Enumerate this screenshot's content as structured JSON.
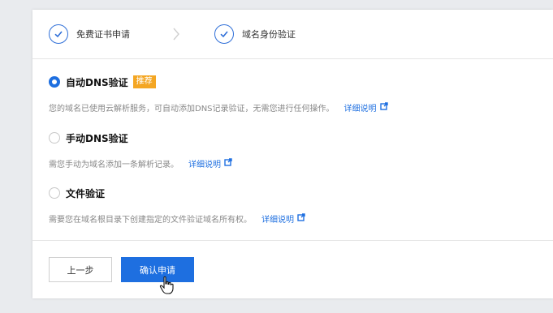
{
  "steps": [
    {
      "label": "免费证书申请"
    },
    {
      "label": "域名身份验证"
    }
  ],
  "options": [
    {
      "title": "自动DNS验证",
      "badge": "推荐",
      "selected": true,
      "description": "您的域名已使用云解析服务，可自动添加DNS记录验证，无需您进行任何操作。",
      "link": "详细说明"
    },
    {
      "title": "手动DNS验证",
      "selected": false,
      "description": "需您手动为域名添加一条解析记录。",
      "link": "详细说明"
    },
    {
      "title": "文件验证",
      "selected": false,
      "description": "需要您在域名根目录下创建指定的文件验证域名所有权。",
      "link": "详细说明"
    }
  ],
  "buttons": {
    "prev": "上一步",
    "confirm": "确认申请"
  },
  "colors": {
    "accent": "#1e6fe0",
    "badge": "#f4a623"
  },
  "icons": {
    "step_done": "check-circle-icon",
    "separator": "chevron-right-icon",
    "external": "external-link-icon",
    "cursor": "hand-pointer-icon"
  }
}
